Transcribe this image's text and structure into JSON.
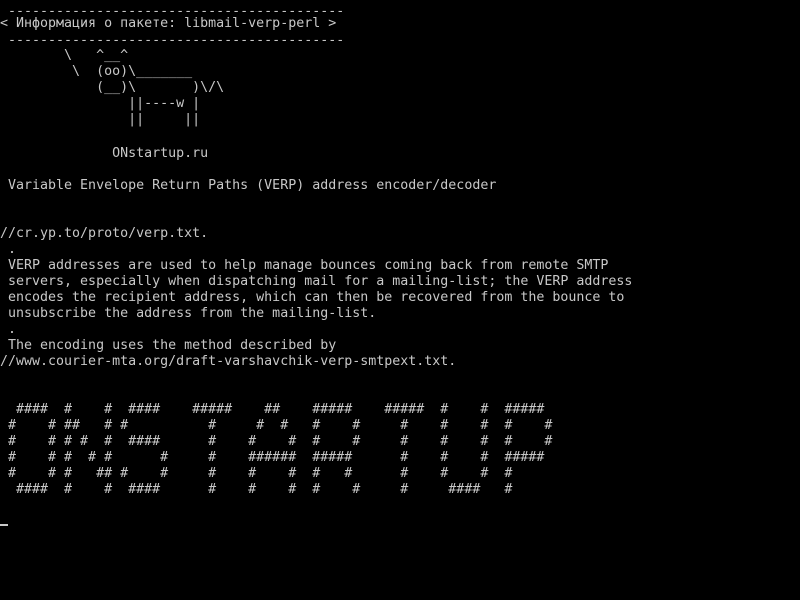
{
  "terminal": {
    "lines": [
      " ------------------------------------------",
      "< Информация о пакете: libmail-verp-perl >",
      " ------------------------------------------",
      "        \\   ^__^",
      "         \\  (oo)\\_______",
      "            (__)\\       )\\/\\",
      "                ||----w |",
      "                ||     ||",
      "",
      "              ONstartup.ru",
      "",
      " Variable Envelope Return Paths (VERP) address encoder/decoder",
      "",
      "",
      "//cr.yp.to/proto/verp.txt.",
      " .",
      " VERP addresses are used to help manage bounces coming back from remote SMTP",
      " servers, especially when dispatching mail for a mailing-list; the VERP address",
      " encodes the recipient address, which can then be recovered from the bounce to",
      " unsubscribe the address from the mailing-list.",
      " .",
      " The encoding uses the method described by",
      "//www.courier-mta.org/draft-varshavchik-verp-smtpext.txt.",
      "",
      "",
      "  ####  #    #  ####    #####    ##    #####    #####  #    #  #####",
      " #    # ##   # #          #     #  #   #    #     #    #    #  #    #",
      " #    # # #  #  ####      #    #    #  #    #     #    #    #  #    #",
      " #    # #  # #      #     #    ######  #####      #    #    #  #####",
      " #    # #   ## #    #     #    #    #  #   #      #    #    #  #",
      "  ####  #    #  ####      #    #    #  #    #     #     ####   #"
    ]
  }
}
